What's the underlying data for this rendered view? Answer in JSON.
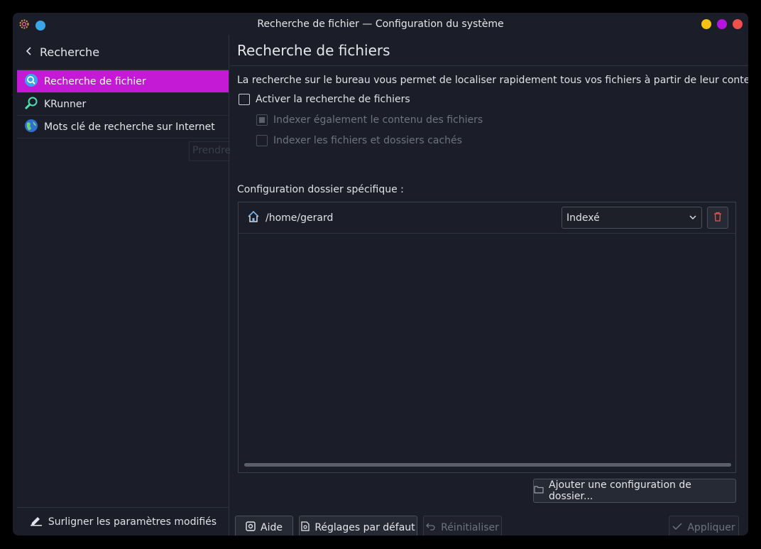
{
  "window": {
    "title": "Recherche de fichier — Configuration du système"
  },
  "colors": {
    "accent": "#c41ad5",
    "min": "#f5c211",
    "max": "#b513e0",
    "close": "#f0504c"
  },
  "sidebar": {
    "header": "Recherche",
    "items": [
      {
        "label": "Recherche de fichier",
        "icon": "file-search-icon",
        "active": true
      },
      {
        "label": "KRunner",
        "icon": "krunner-search-icon",
        "active": false
      },
      {
        "label": "Mots clé de recherche sur Internet",
        "icon": "globe-icon",
        "active": false
      }
    ],
    "ghost_text": "Prendre",
    "footer": "Surligner les paramètres modifiés"
  },
  "main": {
    "title": "Recherche de fichiers",
    "description": "La recherche sur le bureau vous permet de localiser rapidement tous vos fichiers à partir de leur contenu.",
    "enable_label": "Activer la recherche de fichiers",
    "index_content_label": "Indexer également le contenu des fichiers",
    "index_hidden_label": "Indexer les fichiers et dossiers cachés",
    "folder_section_label": "Configuration dossier spécifique :",
    "folders": [
      {
        "path": "/home/gerard",
        "mode": "Indexé"
      }
    ],
    "add_folder_label": "Ajouter une configuration de dossier..."
  },
  "footer_buttons": {
    "help": "Aide",
    "defaults": "Réglages par défaut",
    "reset": "Réinitialiser",
    "apply": "Appliquer"
  }
}
